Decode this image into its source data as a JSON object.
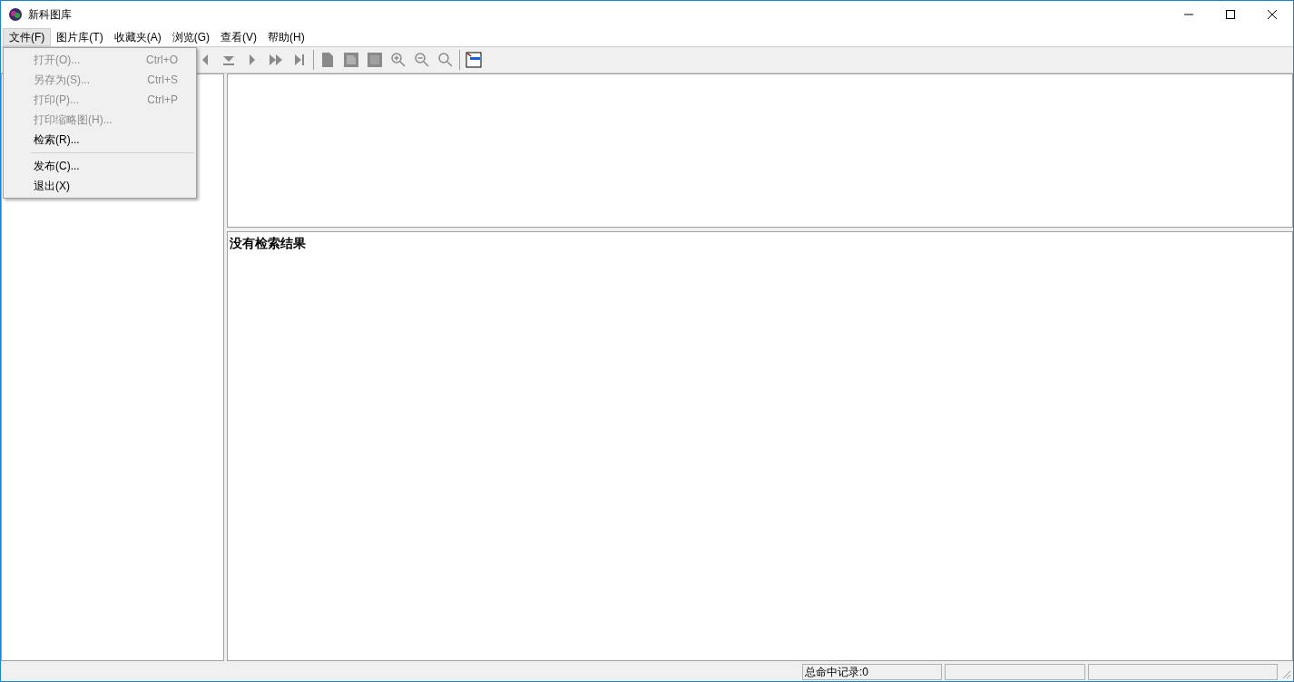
{
  "window": {
    "title": "新科图库"
  },
  "menu_bar": [
    {
      "label": "文件(F)",
      "selected": true
    },
    {
      "label": "图片库(T)",
      "selected": false
    },
    {
      "label": "收藏夹(A)",
      "selected": false
    },
    {
      "label": "浏览(G)",
      "selected": false
    },
    {
      "label": "查看(V)",
      "selected": false
    },
    {
      "label": "帮助(H)",
      "selected": false
    }
  ],
  "file_menu": [
    {
      "kind": "item",
      "label": "打开(O)...",
      "shortcut": "Ctrl+O",
      "disabled": true
    },
    {
      "kind": "item",
      "label": "另存为(S)...",
      "shortcut": "Ctrl+S",
      "disabled": true
    },
    {
      "kind": "item",
      "label": "打印(P)...",
      "shortcut": "Ctrl+P",
      "disabled": true
    },
    {
      "kind": "item",
      "label": "打印缩略图(H)...",
      "disabled": true
    },
    {
      "kind": "item",
      "label": "检索(R)...",
      "disabled": false
    },
    {
      "kind": "separator"
    },
    {
      "kind": "item",
      "label": "发布(C)...",
      "disabled": false
    },
    {
      "kind": "item",
      "label": "退出(X)",
      "disabled": false
    }
  ],
  "results": {
    "message": "没有检索结果"
  },
  "status_bar": {
    "text": "总命中记录:0"
  }
}
